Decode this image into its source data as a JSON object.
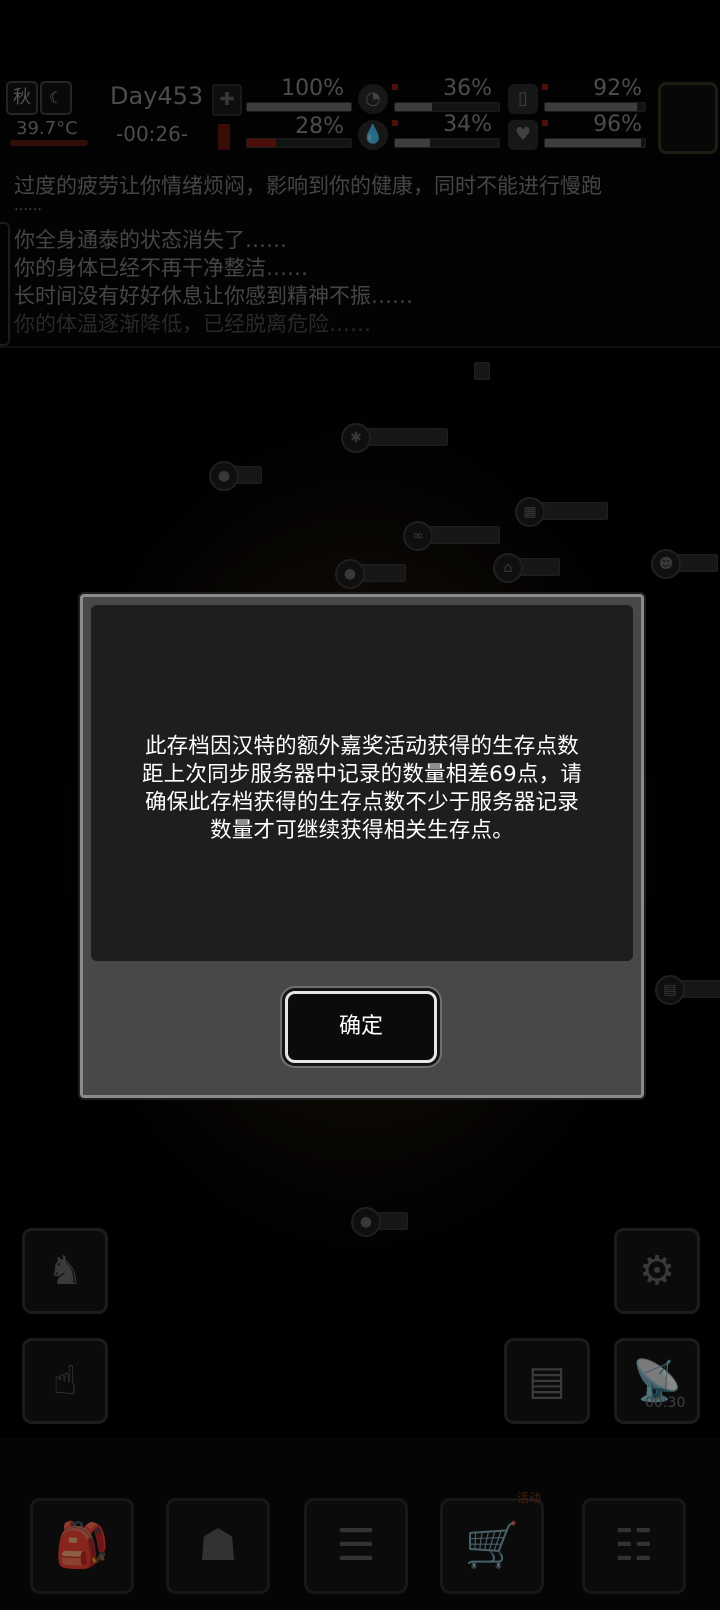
{
  "status": {
    "season": "秋",
    "temperature": "39.7°C",
    "day": "Day453",
    "time": "-00:26-",
    "stats": {
      "health": "100%",
      "satiety": "36%",
      "stamina": "92%",
      "blood": "28%",
      "water": "34%",
      "mood": "96%"
    },
    "levels": {
      "health": 1.0,
      "satiety": 0.36,
      "stamina": 0.92,
      "blood": 0.28,
      "water": 0.34,
      "mood": 0.96
    }
  },
  "messages": [
    "过度的疲劳让你情绪烦闷，影响到你的健康，同时不能进行慢跑",
    "……",
    "你全身通泰的状态消失了……",
    "你的身体已经不再干净整洁……",
    "长时间没有好好休息让你感到精神不振……",
    "你的体温逐渐降低，已经脱离危险……"
  ],
  "map": {
    "right_timer": "00:30"
  },
  "dialog": {
    "message_lines": [
      "此存档因汉特的额外嘉奖活动获得的生存点数",
      "距上次同步服务器中记录的数量相差69点，请",
      "确保此存档获得的生存点数不少于服务器记录",
      "数量才可继续获得相关生存点。"
    ],
    "ok_label": "确定"
  },
  "nav": {
    "shop_badge": "活动"
  },
  "icons": {
    "backpack": "backpack-icon",
    "brain": "brain-icon",
    "journal": "journal-icon",
    "cart": "cart-icon",
    "menu": "menu-icon"
  },
  "colors": {
    "dialog_border": "#8b8b8b",
    "dialog_bg": "#1e1e1e",
    "danger_bar": "#8a1c12"
  }
}
